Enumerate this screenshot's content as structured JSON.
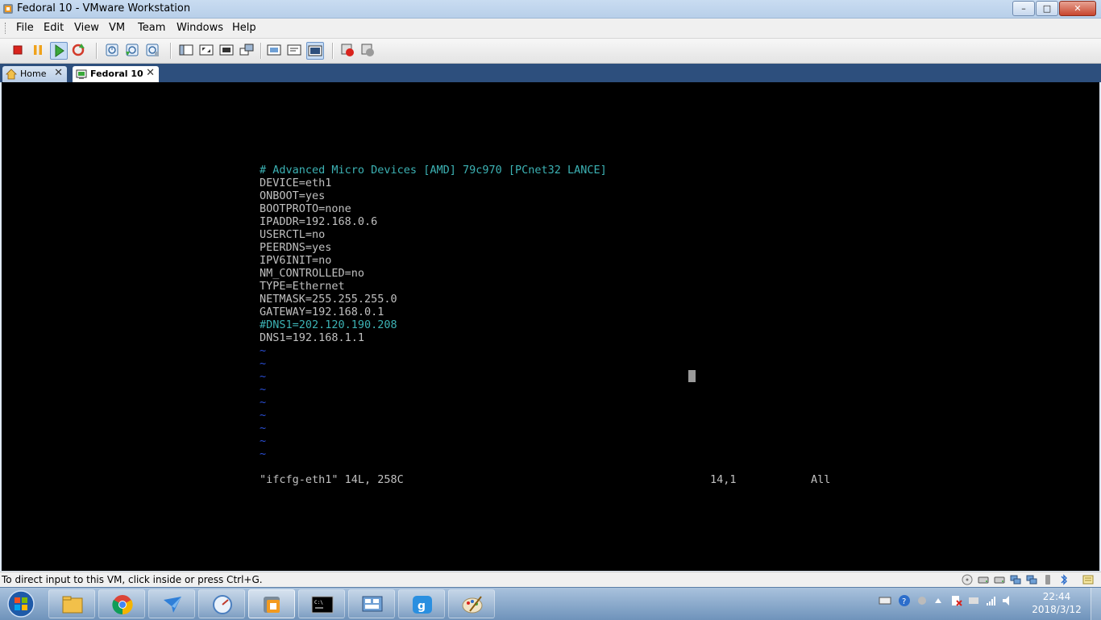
{
  "window": {
    "title": "Fedoral 10 - VMware Workstation",
    "controls": {
      "minimize": "–",
      "maximize": "□",
      "close": "✕"
    }
  },
  "menu": [
    "File",
    "Edit",
    "VM",
    "Team",
    "Windows",
    "Help"
  ],
  "toolbar_icons": [
    "power-off-icon",
    "pause-icon",
    "play-icon",
    "reset-icon",
    "snapshot-icon",
    "revert-snapshot-icon",
    "snapshot-manager-icon",
    "sidebar-icon",
    "fullscreen-icon",
    "quick-switch-icon",
    "unity-icon",
    "summary-view-icon",
    "appliance-view-icon",
    "console-view-icon",
    "team-icon",
    "preferences-icon"
  ],
  "tabs": {
    "home": {
      "label": "Home",
      "close": "✕"
    },
    "vm": {
      "label": "Fedoral 10",
      "close": "✕"
    }
  },
  "terminal": {
    "lines": [
      {
        "text": "# Advanced Micro Devices [AMD] 79c970 [PCnet32 LANCE]",
        "color": "cyan"
      },
      {
        "text": "DEVICE=eth1",
        "color": "white"
      },
      {
        "text": "ONBOOT=yes",
        "color": "white"
      },
      {
        "text": "BOOTPROTO=none",
        "color": "white"
      },
      {
        "text": "IPADDR=192.168.0.6",
        "color": "white"
      },
      {
        "text": "USERCTL=no",
        "color": "white"
      },
      {
        "text": "PEERDNS=yes",
        "color": "white"
      },
      {
        "text": "IPV6INIT=no",
        "color": "white"
      },
      {
        "text": "NM_CONTROLLED=no",
        "color": "white"
      },
      {
        "text": "TYPE=Ethernet",
        "color": "white"
      },
      {
        "text": "NETMASK=255.255.255.0",
        "color": "white"
      },
      {
        "text": "GATEWAY=192.168.0.1",
        "color": "white"
      },
      {
        "text": "#DNS1=202.120.190.208",
        "color": "cyan"
      },
      {
        "text": "DNS1=192.168.1.1",
        "color": "white"
      }
    ],
    "tilde": "~",
    "tilde_count": 9,
    "status_file": "\"ifcfg-eth1\" 14L, 258C",
    "status_pos": "14,1",
    "status_scroll": "All"
  },
  "statusbar": {
    "message": "To direct input to this VM, click inside or press Ctrl+G."
  },
  "taskbar": {
    "apps": [
      "explorer-icon",
      "chrome-icon",
      "feishu-icon",
      "clock-app-icon",
      "vmware-icon",
      "cmd-icon",
      "control-panel-icon",
      "hand-app-icon",
      "paint-icon"
    ],
    "clock": {
      "time": "22:44",
      "date": "2018/3/12"
    }
  },
  "colors": {
    "titlebar": "#c9dcf1",
    "tabstrip": "#2d4f7d",
    "terminal_bg": "#000000",
    "terminal_fg": "#c0c0c0",
    "terminal_cyan": "#3cb2b4",
    "tilde_blue": "#2a4fd6"
  }
}
